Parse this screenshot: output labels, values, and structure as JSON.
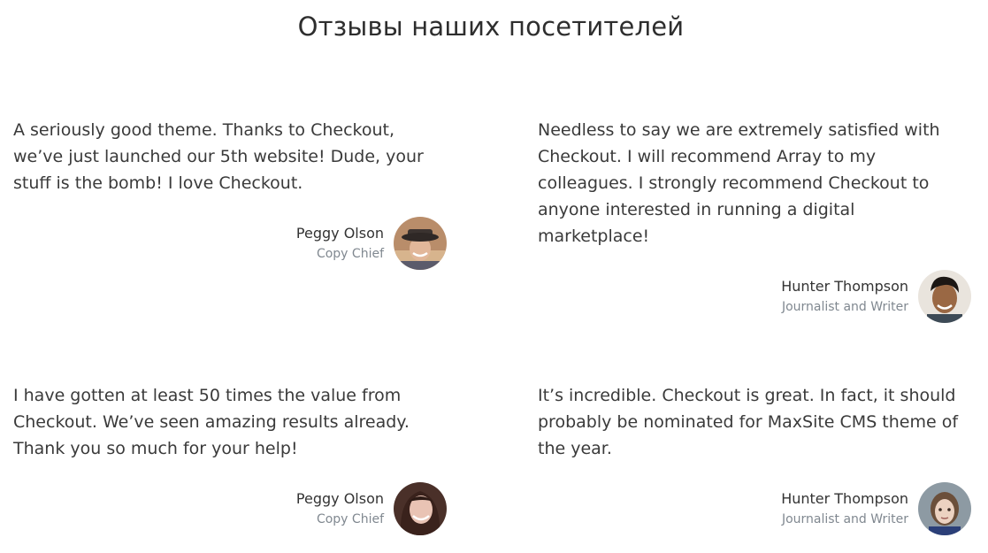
{
  "page": {
    "title": "Отзывы наших посетителей"
  },
  "testimonials": [
    {
      "quote": "A seriously good theme. Thanks to Checkout, we’ve just launched our 5th website! Dude, your stuff is the bomb! I love Checkout.",
      "name": "Peggy Olson",
      "role": "Copy Chief",
      "avatar": "man-with-hat-photo"
    },
    {
      "quote": "Needless to say we are extremely satisfied with Checkout. I will recommend Array to my colleagues. I strongly recommend Checkout to anyone interested in running a digital marketplace!",
      "name": "Hunter Thompson",
      "role": "Journalist and Writer",
      "avatar": "smiling-man-photo"
    },
    {
      "quote": "I have gotten at least 50 times the value from Checkout. We’ve seen amazing results already. Thank you so much for your help!",
      "name": "Peggy Olson",
      "role": "Copy Chief",
      "avatar": "smiling-woman-photo"
    },
    {
      "quote": "It’s incredible. Checkout is great. In fact, it should probably be nominated for MaxSite CMS theme of the year.",
      "name": "Hunter Thompson",
      "role": "Journalist and Writer",
      "avatar": "child-portrait-photo"
    }
  ],
  "colors": {
    "text": "#3a3a3a",
    "role": "#808890",
    "background": "#ffffff"
  }
}
